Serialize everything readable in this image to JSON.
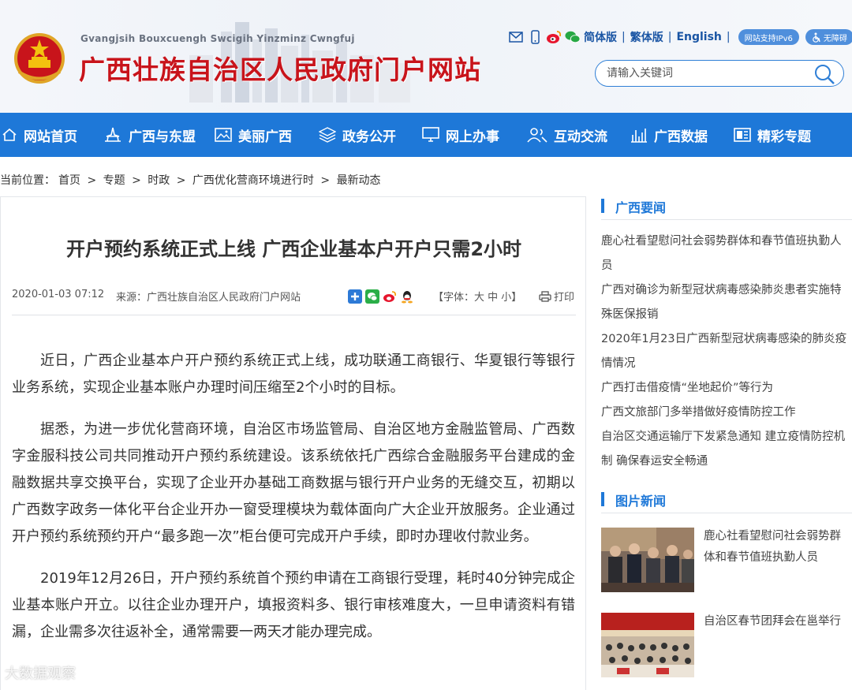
{
  "header": {
    "subtitle": "Gvangjsih Bouxcuengh Swcigih Yinzminz Cwngfuj",
    "title": "广西壮族自治区人民政府门户网站",
    "links": [
      "简体版",
      "繁体版",
      "English"
    ],
    "ipv6_label": "网站支持IPv6",
    "accessible_label": "无障碍",
    "search_placeholder": "请输入关键词"
  },
  "nav": {
    "items": [
      {
        "label": "网站首页",
        "icon": "home-icon"
      },
      {
        "label": "广西与东盟",
        "icon": "landmark-icon"
      },
      {
        "label": "美丽广西",
        "icon": "picture-icon"
      },
      {
        "label": "政务公开",
        "icon": "layers-icon"
      },
      {
        "label": "网上办事",
        "icon": "monitor-icon"
      },
      {
        "label": "互动交流",
        "icon": "users-icon"
      },
      {
        "label": "广西数据",
        "icon": "bar-chart-icon"
      },
      {
        "label": "精彩专题",
        "icon": "topic-icon"
      }
    ]
  },
  "breadcrumb": {
    "prefix": "当前位置：",
    "items": [
      "首页",
      "专题",
      "时政",
      "广西优化营商环境进行时",
      "最新动态"
    ],
    "sep": ">"
  },
  "article": {
    "title": "开户预约系统正式上线 广西企业基本户开户只需2小时",
    "date": "2020-01-03 07:12",
    "source": "来源：广西壮族自治区人民政府门户网站",
    "font_label": "【字体：大 中 小】",
    "print_label": "打印",
    "paragraphs": [
      "近日，广西企业基本户开户预约系统正式上线，成功联通工商银行、华夏银行等银行业务系统，实现企业基本账户办理时间压缩至2个小时的目标。",
      "据悉，为进一步优化营商环境，自治区市场监管局、自治区地方金融监管局、广西数字金服科技公司共同推动开户预约系统建设。该系统依托广西综合金融服务平台建成的金融数据共享交换平台，实现了企业开办基础工商数据与银行开户业务的无缝交互，初期以广西数字政务一体化平台企业开办一窗受理模块为载体面向广大企业开放服务。企业通过开户预约系统预约开户“最多跑一次”柜台便可完成开户手续，即时办理收付款业务。",
      "2019年12月26日，开户预约系统首个预约申请在工商银行受理，耗时40分钟完成企业基本账户开立。以往企业办理开户，填报资料多、银行审核难度大，一旦申请资料有错漏，企业需多次往返补全，通常需要一两天才能办理完成。"
    ]
  },
  "sidebar": {
    "news_title": "广西要闻",
    "news": [
      "鹿心社看望慰问社会弱势群体和春节值班执勤人员",
      "广西对确诊为新型冠状病毒感染肺炎患者实施特殊医保报销",
      "2020年1月23日广西新型冠状病毒感染的肺炎疫情情况",
      "广西打击借疫情“坐地起价”等行为",
      "广西文旅部门多举措做好疫情防控工作",
      "自治区交通运输厅下发紧急通知 建立疫情防控机制 确保春运安全畅通"
    ],
    "photo_title": "图片新闻",
    "photos": [
      {
        "caption": "鹿心社看望慰问社会弱势群体和春节值班执勤人员"
      },
      {
        "caption": "自治区春节团拜会在邕举行"
      }
    ]
  },
  "watermark": "大数据观察",
  "colors": {
    "brand_red": "#c8141b",
    "nav_blue": "#1e78d8",
    "link_blue": "#1a55a4"
  }
}
